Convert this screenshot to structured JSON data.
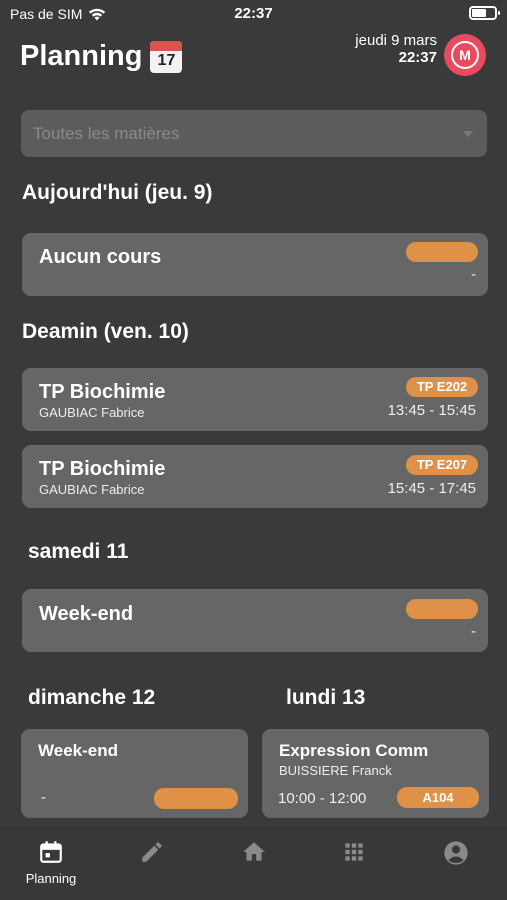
{
  "status": {
    "carrier": "Pas de SIM",
    "time": "22:37"
  },
  "header": {
    "title": "Planning",
    "calendar_day": "17",
    "date": "jeudi 9 mars",
    "time": "22:37",
    "avatar_letter": "M"
  },
  "filter": {
    "placeholder": "Toutes les matières"
  },
  "sections": [
    {
      "title": "Aujourd'hui (jeu. 9)"
    },
    {
      "title": "Deamin (ven. 10)"
    },
    {
      "title": "samedi 11"
    },
    {
      "title": "dimanche 12"
    },
    {
      "title": "lundi 13"
    }
  ],
  "cards": [
    {
      "title": "Aucun cours",
      "teacher": "",
      "room": "",
      "time": "-"
    },
    {
      "title": "TP Biochimie",
      "teacher": "GAUBIAC Fabrice",
      "room": "TP E202",
      "time": "13:45 - 15:45"
    },
    {
      "title": "TP Biochimie",
      "teacher": "GAUBIAC Fabrice",
      "room": "TP E207",
      "time": "15:45 - 17:45"
    },
    {
      "title": "Week-end",
      "teacher": "",
      "room": "",
      "time": "-"
    },
    {
      "title": "Week-end",
      "teacher": "",
      "room": "",
      "time": "-"
    },
    {
      "title": "Expression Comm",
      "teacher": "BUISSIERE Franck",
      "room": "A104",
      "time": "10:00 - 12:00"
    }
  ],
  "tabbar": {
    "items": [
      {
        "icon": "calendar-icon",
        "label": "Planning",
        "active": true
      },
      {
        "icon": "pencil-icon",
        "label": ""
      },
      {
        "icon": "home-icon",
        "label": ""
      },
      {
        "icon": "grid-icon",
        "label": ""
      },
      {
        "icon": "account-icon",
        "label": ""
      }
    ]
  },
  "colors": {
    "background": "#3a3a3a",
    "card": "#666666",
    "accent": "#de9147",
    "avatar": "#e84a5f"
  }
}
